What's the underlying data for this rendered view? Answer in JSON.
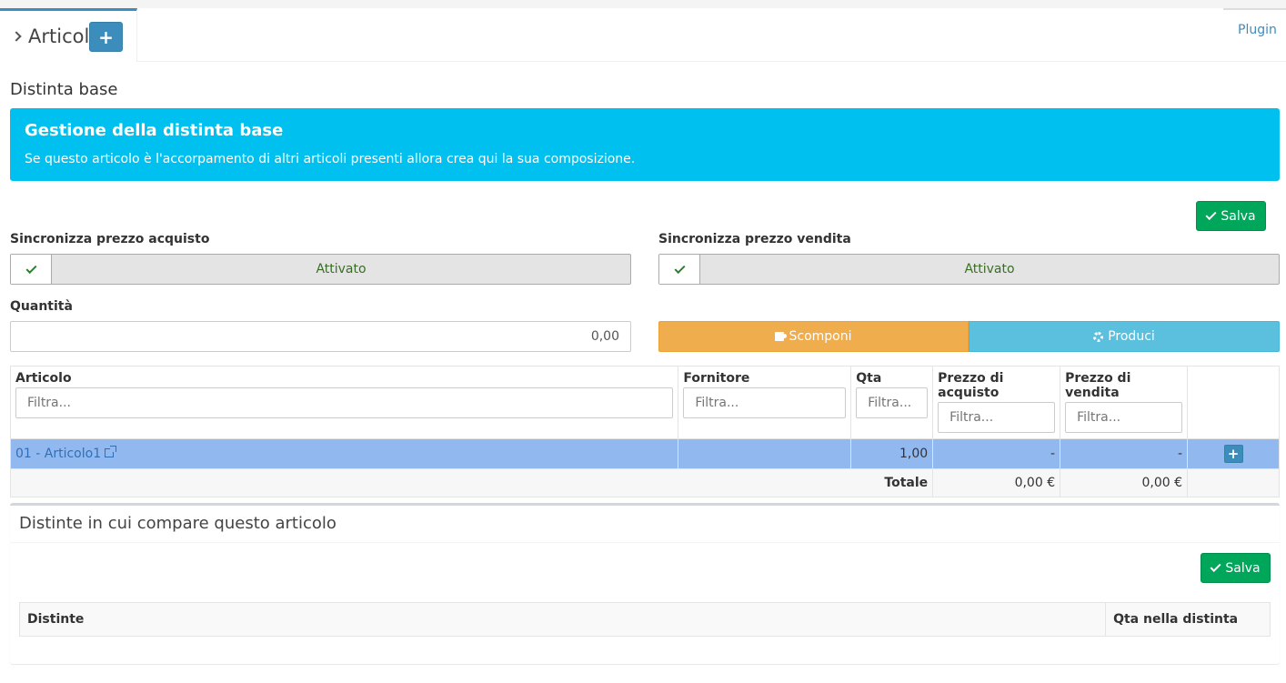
{
  "tabs": {
    "active_label": "Articoli",
    "add_label": "+",
    "plugin_label": "Plugin"
  },
  "section": {
    "title": "Distinta base"
  },
  "callout": {
    "title": "Gestione della distinta base",
    "text": "Se questo articolo è l'accorpamento di altri articoli presenti allora crea qui la sua composizione."
  },
  "buttons": {
    "save_label": "Salva",
    "decompose_label": "Scomponi",
    "produce_label": "Produci",
    "row_add_label": "+"
  },
  "sync": {
    "purchase_label": "Sincronizza prezzo acquisto",
    "purchase_state": "Attivato",
    "sale_label": "Sincronizza prezzo vendita",
    "sale_state": "Attivato"
  },
  "quantity": {
    "label": "Quantità",
    "value": "0,00"
  },
  "table": {
    "headers": [
      "Articolo",
      "Fornitore",
      "Qta",
      "Prezzo di acquisto",
      "Prezzo di vendita"
    ],
    "filter_placeholder": "Filtra...",
    "rows": [
      {
        "articolo": "01 - Articolo1",
        "fornitore": "",
        "qta": "1,00",
        "acquisto": "-",
        "vendita": "-"
      }
    ],
    "total_label": "Totale",
    "total_acquisto": "0,00 €",
    "total_vendita": "0,00 €"
  },
  "distinte_box": {
    "title": "Distinte in cui compare questo articolo",
    "headers": [
      "Distinte",
      "Qta nella distinta"
    ]
  },
  "colors": {
    "primary": "#3c8dbc",
    "info": "#00c0ef",
    "success": "#00a65a",
    "warning": "#f0ad4e",
    "cyan": "#5bc0de",
    "selected_row": "#92b9ef"
  }
}
